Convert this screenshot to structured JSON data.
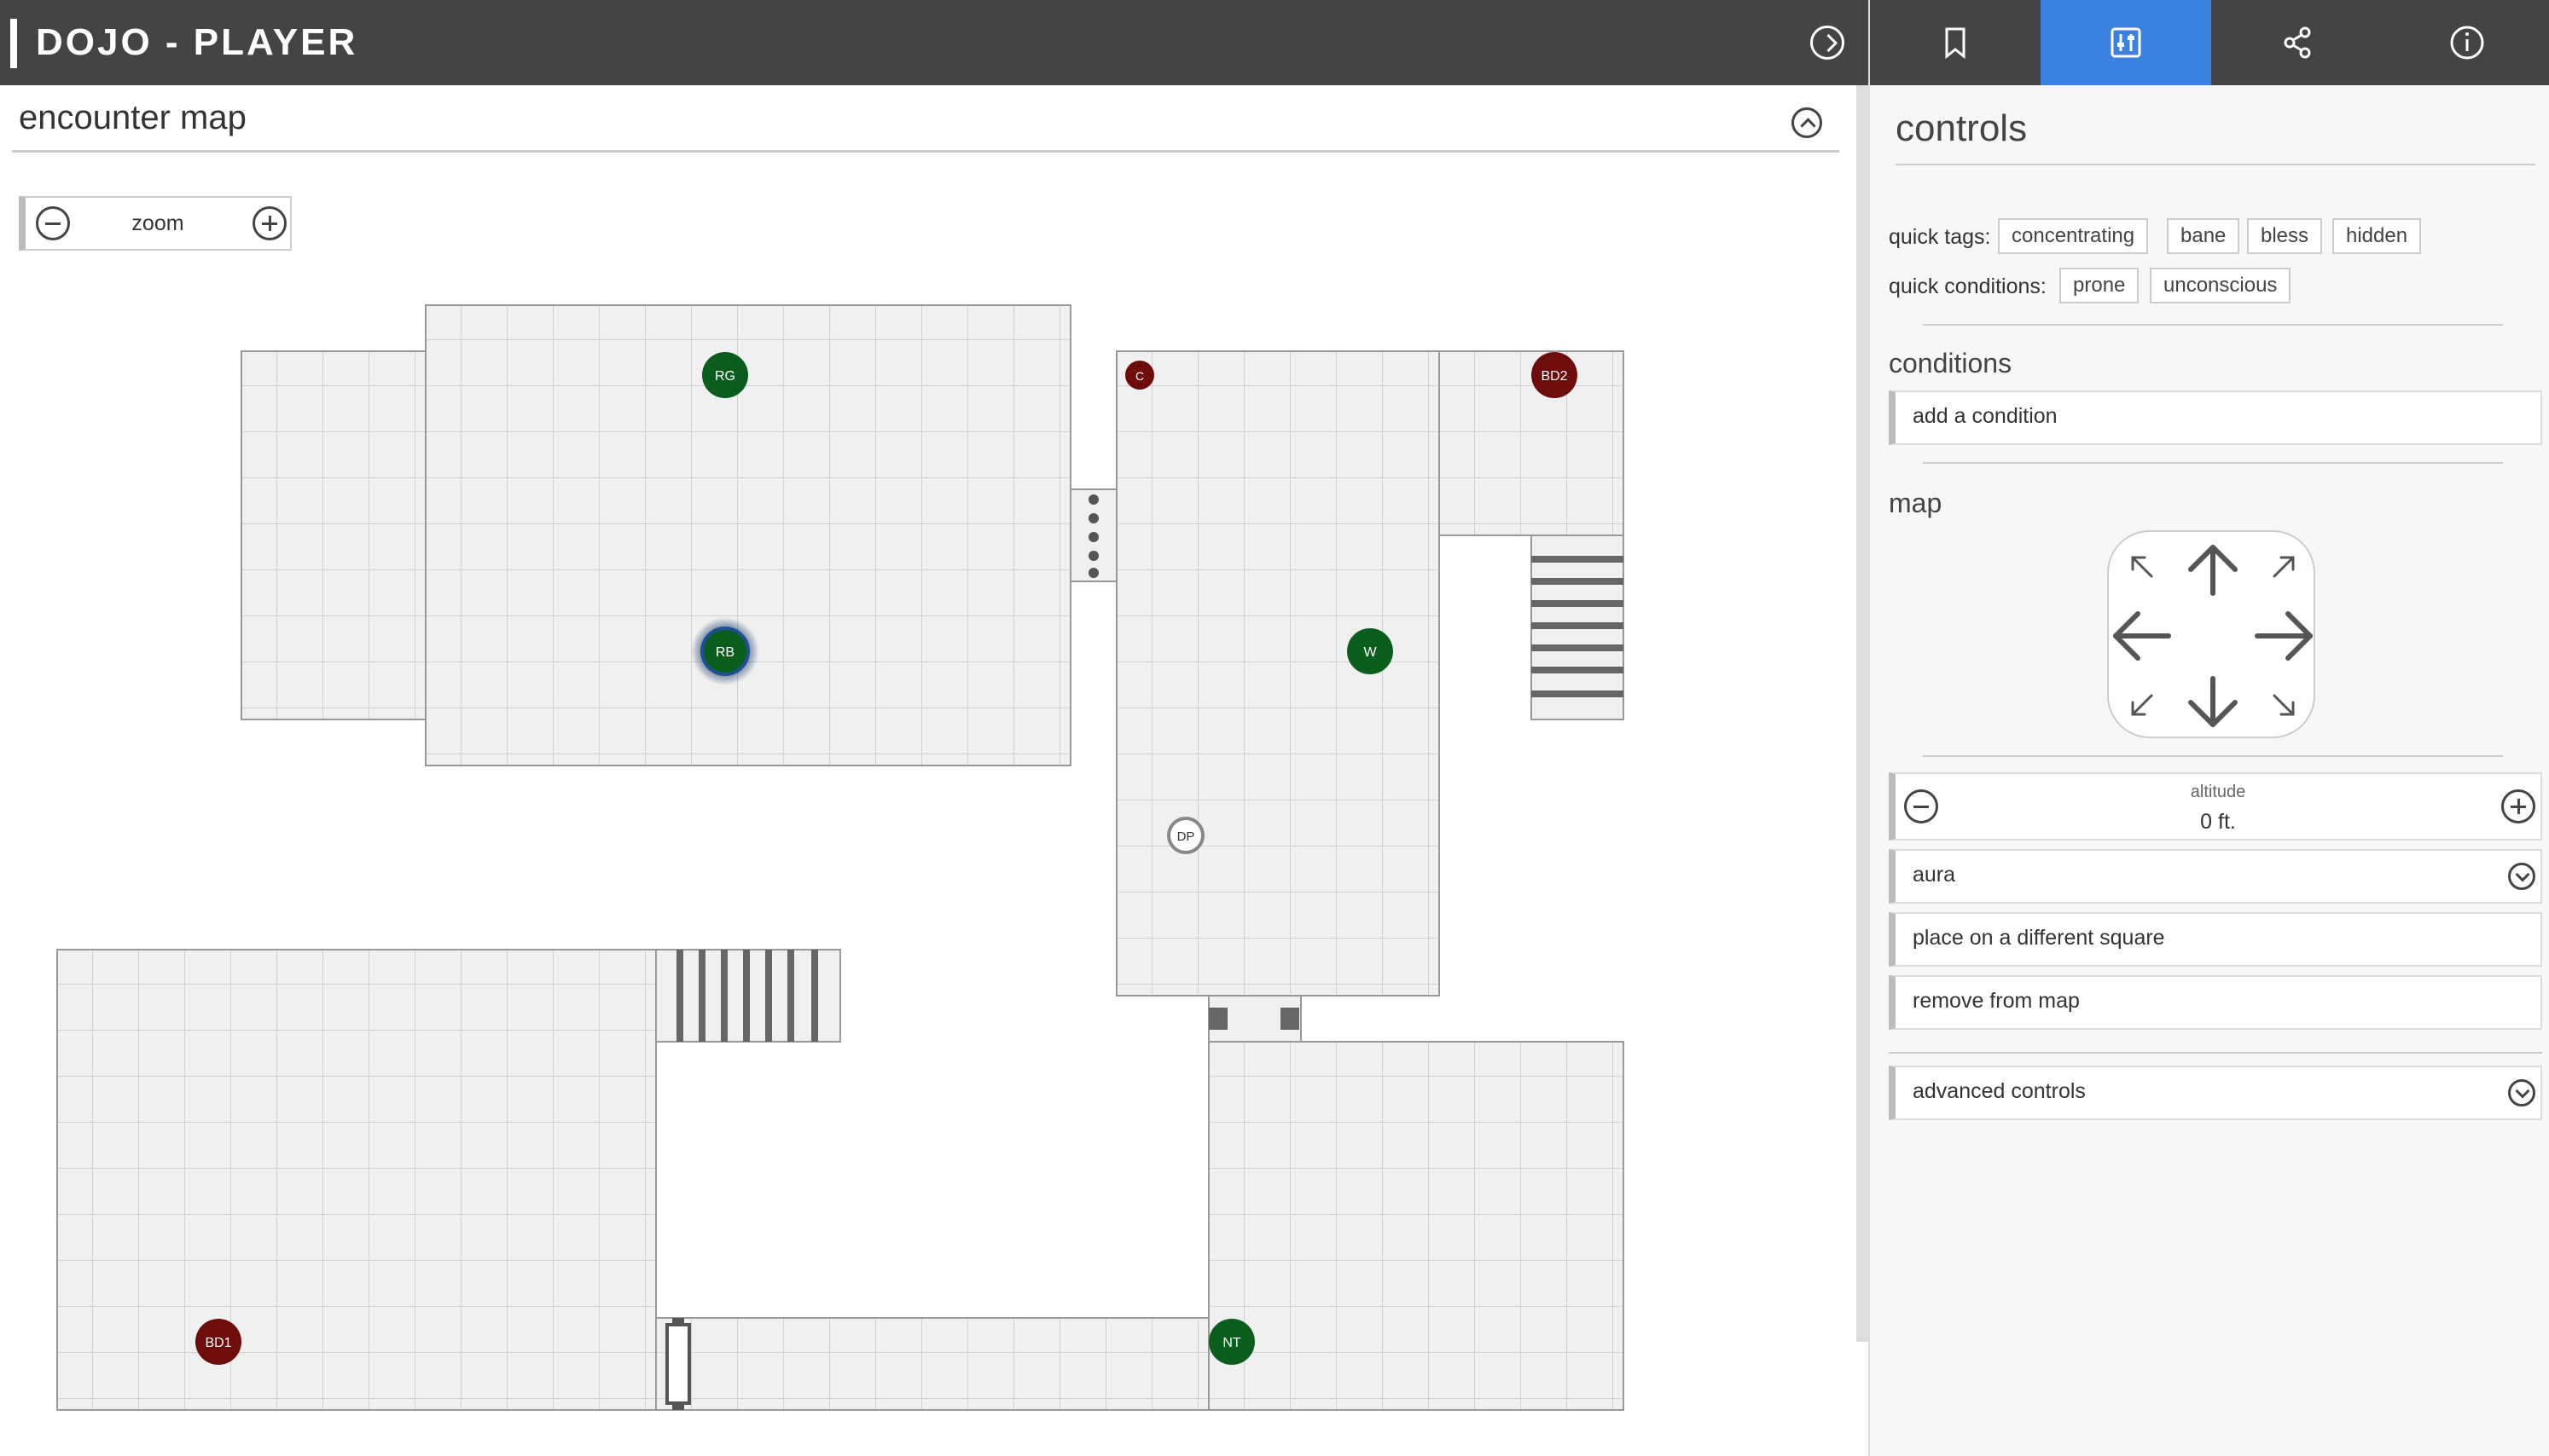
{
  "app": {
    "title": "DOJO - PLAYER"
  },
  "map_panel": {
    "title": "encounter map",
    "zoom_label": "zoom"
  },
  "tokens": [
    {
      "id": "RG",
      "color": "#0b5d1e",
      "kind": "ally"
    },
    {
      "id": "RB",
      "color": "#0b5d1e",
      "kind": "ally-selected"
    },
    {
      "id": "C",
      "color": "#6e0b0b",
      "kind": "enemy"
    },
    {
      "id": "BD2",
      "color": "#6e0b0b",
      "kind": "enemy"
    },
    {
      "id": "W",
      "color": "#0b5d1e",
      "kind": "ally"
    },
    {
      "id": "DP",
      "color": "#ffffff",
      "kind": "neutral"
    },
    {
      "id": "BD1",
      "color": "#6e0b0b",
      "kind": "enemy"
    },
    {
      "id": "NT",
      "color": "#0b5d1e",
      "kind": "ally"
    }
  ],
  "tabs": [
    {
      "icon": "bookmark-icon",
      "active": false
    },
    {
      "icon": "sliders-icon",
      "active": true
    },
    {
      "icon": "share-icon",
      "active": false
    },
    {
      "icon": "info-icon",
      "active": false
    }
  ],
  "controls": {
    "title": "controls",
    "quick_tags_label": "quick tags:",
    "quick_tags": [
      "concentrating",
      "bane",
      "bless",
      "hidden"
    ],
    "quick_conditions_label": "quick conditions:",
    "quick_conditions": [
      "prone",
      "unconscious"
    ],
    "conditions_title": "conditions",
    "add_condition": "add a condition",
    "map_title": "map",
    "altitude_label": "altitude",
    "altitude_value": "0 ft.",
    "aura": "aura",
    "place_different": "place on a different square",
    "remove_from_map": "remove from map",
    "advanced_controls": "advanced controls"
  },
  "colors": {
    "topbar": "#444444",
    "active_tab": "#3b82e0",
    "ally": "#0b5d1e",
    "enemy": "#6e0b0b"
  }
}
